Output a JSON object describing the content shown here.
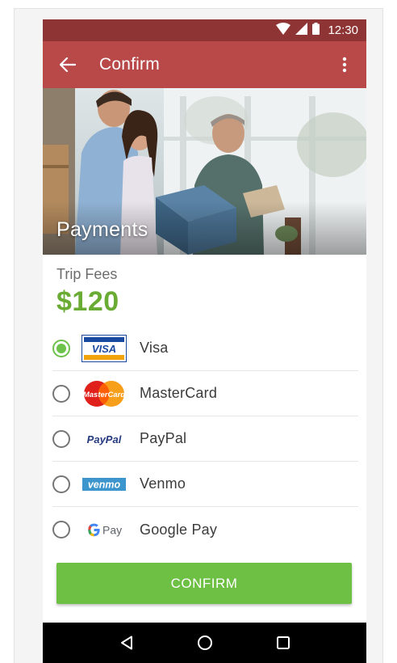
{
  "status_bar": {
    "time": "12:30",
    "icons": [
      "wifi-icon",
      "signal-icon",
      "battery-icon"
    ]
  },
  "app_bar": {
    "title": "Confirm",
    "back_icon": "arrow-left-icon",
    "menu_icon": "more-vert-icon"
  },
  "hero": {
    "title": "Payments"
  },
  "fees": {
    "label": "Trip Fees",
    "amount": "$120"
  },
  "payment_methods": [
    {
      "label": "Visa",
      "logo_text": "VISA",
      "selected": true
    },
    {
      "label": "MasterCard",
      "logo_text": "MasterCard",
      "selected": false
    },
    {
      "label": "PayPal",
      "logo_text": "PayPal",
      "selected": false
    },
    {
      "label": "Venmo",
      "logo_text": "venmo",
      "selected": false
    },
    {
      "label": "Google Pay",
      "logo_text": "Pay",
      "selected": false
    }
  ],
  "confirm_button": {
    "label": "CONFIRM"
  },
  "nav_bar": {
    "icons": [
      "back-triangle-icon",
      "home-circle-icon",
      "recents-square-icon"
    ]
  },
  "colors": {
    "status_bar": "#8f3434",
    "app_bar": "#b94848",
    "accent_green": "#6cc24a",
    "amount_green": "#6aab33",
    "nav_bar": "#000000"
  }
}
